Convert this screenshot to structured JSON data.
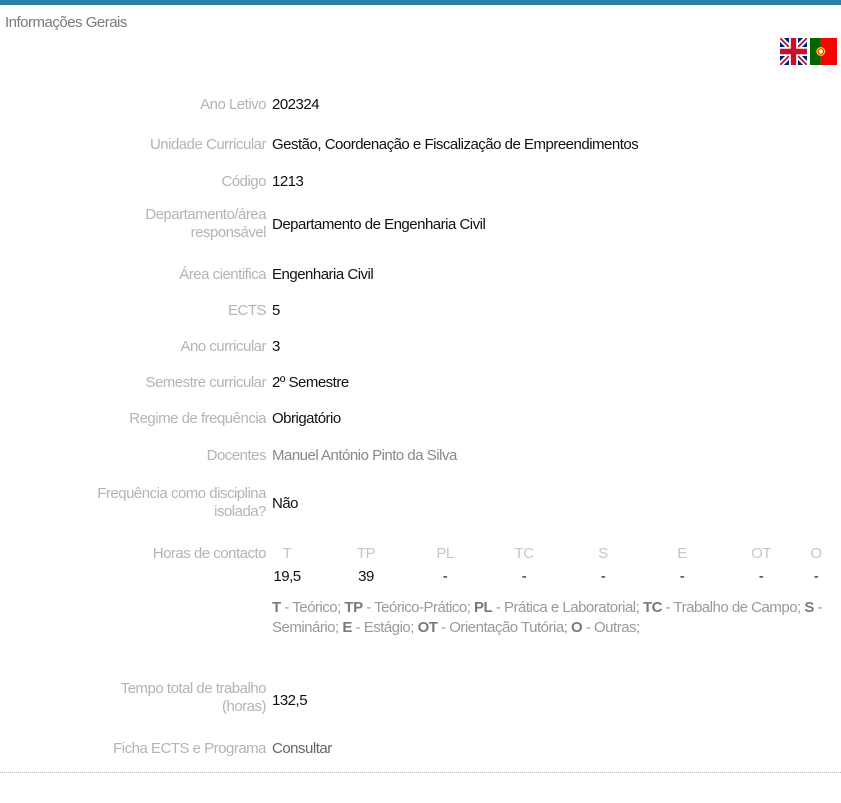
{
  "header": {
    "title": "Informações Gerais",
    "accent_color": "#2a7fa8"
  },
  "languages": [
    {
      "code": "en",
      "icon": "uk-flag-icon"
    },
    {
      "code": "pt",
      "icon": "portugal-flag-icon"
    }
  ],
  "fields": {
    "ano_letivo": {
      "label": "Ano Letivo",
      "value": "202324"
    },
    "unidade_curricular": {
      "label": "Unidade Curricular",
      "value": "Gestão, Coordenação e Fiscalização de Empreendimentos"
    },
    "codigo": {
      "label": "Código",
      "value": "1213"
    },
    "departamento": {
      "label_line1": "Departamento/área",
      "label_line2": "responsável",
      "value": "Departamento de Engenharia Civil"
    },
    "area_cientifica": {
      "label": "Área cientifica",
      "value": "Engenharia Civil"
    },
    "ects": {
      "label": "ECTS",
      "value": "5"
    },
    "ano_curricular": {
      "label": "Ano curricular",
      "value": "3"
    },
    "semestre": {
      "label": "Semestre curricular",
      "value": "2º Semestre"
    },
    "regime": {
      "label": "Regime de frequência",
      "value": "Obrigatório"
    },
    "docentes": {
      "label": "Docentes",
      "value": "Manuel António Pinto da Silva"
    },
    "frequencia_isolada": {
      "label_line1": "Frequência como disciplina",
      "label_line2": "isolada?",
      "value": "Não"
    },
    "horas_contacto": {
      "label": "Horas de contacto"
    },
    "tempo_total": {
      "label_line1": "Tempo total de trabalho",
      "label_line2": "(horas)",
      "value": "132,5"
    },
    "ficha_ects": {
      "label": "Ficha ECTS e Programa",
      "value": "Consultar"
    }
  },
  "hours": {
    "headers": [
      "T",
      "TP",
      "PL",
      "TC",
      "S",
      "E",
      "OT",
      "O"
    ],
    "values": [
      "19,5",
      "39",
      "-",
      "-",
      "-",
      "-",
      "-",
      "-"
    ]
  },
  "legend": [
    {
      "abbr": "T",
      "desc": " - Teórico;  "
    },
    {
      "abbr": "TP",
      "desc": " - Teórico-Prático;  "
    },
    {
      "abbr": "PL",
      "desc": " - Prática e Laboratorial;  "
    },
    {
      "abbr": "TC",
      "desc": " - Trabalho de Campo;  "
    },
    {
      "abbr": "S",
      "desc": " - Seminário;  "
    },
    {
      "abbr": "E",
      "desc": " - Estágio;  "
    },
    {
      "abbr": "OT",
      "desc": " - Orientação Tutória;  "
    },
    {
      "abbr": "O",
      "desc": " - Outras;"
    }
  ]
}
